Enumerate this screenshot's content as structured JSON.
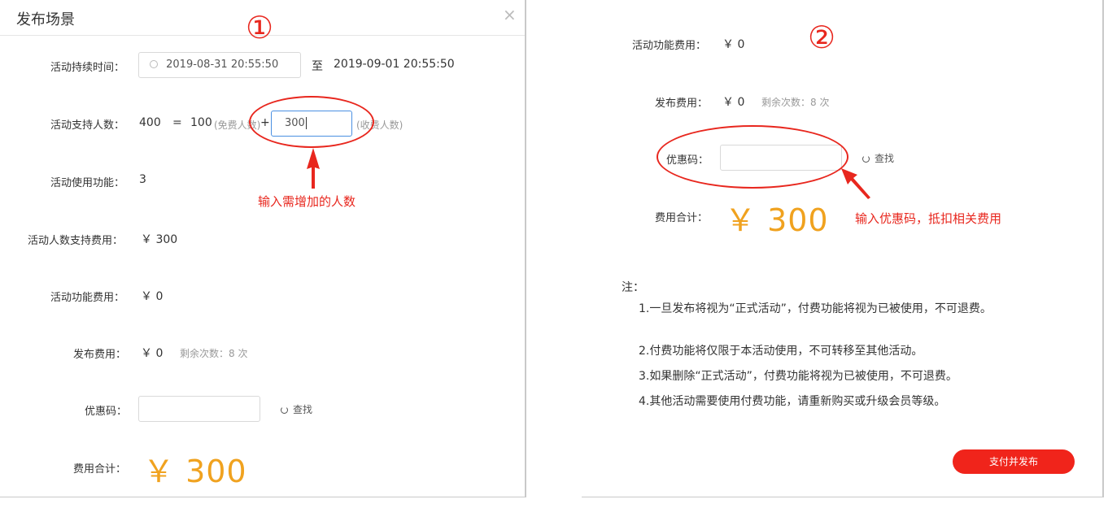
{
  "colors": {
    "accent_orange": "#f0a21f",
    "annotation_red": "#e8271e",
    "pay_button": "#f0241b",
    "focus_blue": "#4a90e2"
  },
  "left": {
    "title": "发布场景",
    "close_icon": "close-icon",
    "annotation_number": "①",
    "duration": {
      "label": "活动持续时间：",
      "start": "2019-08-31 20:55:50",
      "separator": "至",
      "end": "2019-09-01 20:55:50",
      "icon": "clock-icon"
    },
    "capacity": {
      "label": "活动支持人数：",
      "total": "400",
      "equals": "=",
      "free": "100",
      "free_note": "(免费人数)",
      "plus": "+",
      "paid_value": "300",
      "paid_note": "(收费人数)"
    },
    "annotation_text": "输入需增加的人数",
    "features": {
      "label": "活动使用功能：",
      "value": "3"
    },
    "capacity_fee": {
      "label": "活动人数支持费用：",
      "value": "￥ 300"
    },
    "feature_fee": {
      "label": "活动功能费用：",
      "value": "￥ 0"
    },
    "publish_fee": {
      "label": "发布费用：",
      "value": "￥ 0",
      "remaining": "剩余次数：8 次"
    },
    "coupon": {
      "label": "优惠码：",
      "value": "",
      "search_label": "查找",
      "search_icon": "refresh-icon"
    },
    "total": {
      "label": "费用合计：",
      "value": "￥ 300"
    }
  },
  "right": {
    "annotation_number": "②",
    "feature_fee": {
      "label": "活动功能费用：",
      "value": "￥ 0"
    },
    "publish_fee": {
      "label": "发布费用：",
      "value": "￥ 0",
      "remaining": "剩余次数：8 次"
    },
    "coupon": {
      "label": "优惠码：",
      "value": "",
      "search_label": "查找",
      "search_icon": "refresh-icon"
    },
    "annotation_text": "输入优惠码，抵扣相关费用",
    "total": {
      "label": "费用合计：",
      "value": "￥ 300"
    },
    "notes": {
      "heading": "注：",
      "items": [
        "1.一旦发布将视为“正式活动”，付费功能将视为已被使用，不可退费。",
        "2.付费功能将仅限于本活动使用，不可转移至其他活动。",
        "3.如果删除“正式活动”，付费功能将视为已被使用，不可退费。",
        "4.其他活动需要使用付费功能，请重新购买或升级会员等级。"
      ]
    },
    "pay_button": "支付并发布"
  }
}
